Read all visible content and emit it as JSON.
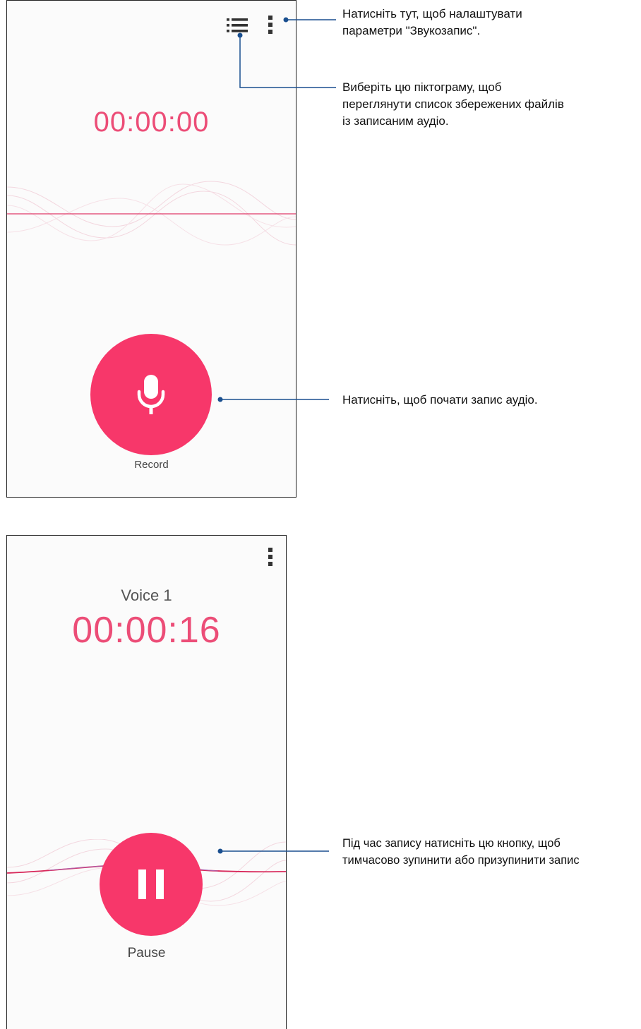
{
  "screen1": {
    "timer": "00:00:00",
    "record_label": "Record"
  },
  "screen2": {
    "voice_name": "Voice 1",
    "timer": "00:00:16",
    "pause_label": "Pause"
  },
  "callouts": {
    "settings": {
      "line1": "Натисніть тут, щоб налаштувати",
      "line2": "параметри \"Звукозапис\"."
    },
    "list": {
      "line1": "Виберіть цю піктограму, щоб",
      "line2": "переглянути список збережених файлів",
      "line3": "із записаним аудіо."
    },
    "record": {
      "line1": "Натисніть, щоб почати запис аудіо."
    },
    "pause": {
      "line1": "Під час запису натисніть цю кнопку, щоб",
      "line2": "тимчасово зупинити або призупинити запис"
    }
  },
  "colors": {
    "accent": "#f7376a",
    "timer": "#ec4d77",
    "callout_line": "#1a4f8f"
  },
  "icons": [
    "list-icon",
    "more-vert-icon",
    "microphone-icon",
    "pause-icon"
  ]
}
